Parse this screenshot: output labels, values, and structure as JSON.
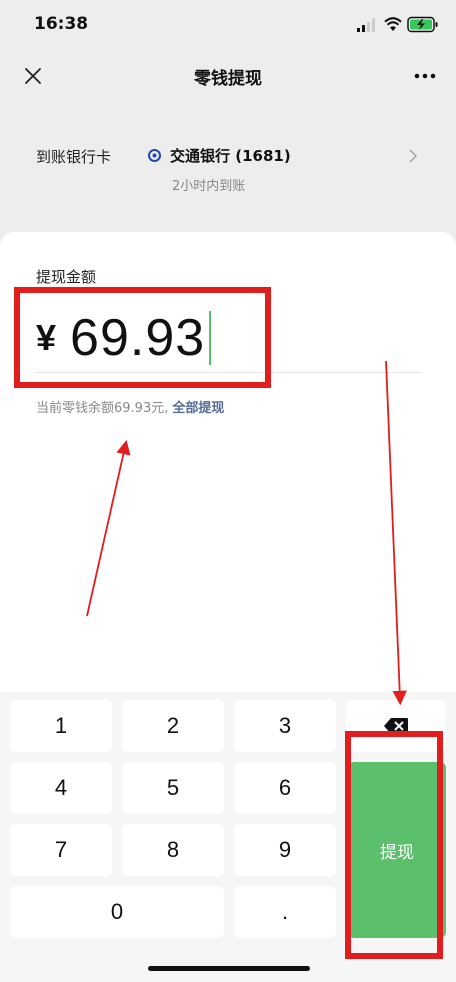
{
  "status_bar": {
    "time": "16:38"
  },
  "nav": {
    "title": "零钱提现"
  },
  "bank": {
    "label": "到账银行卡",
    "name": "交通银行 (1681)",
    "arrival": "2小时内到账"
  },
  "amount": {
    "label": "提现金额",
    "currency": "¥",
    "value": "69.93",
    "balance_text": "当前零钱余额69.93元,",
    "withdraw_all": "全部提现"
  },
  "keypad": {
    "keys": [
      "1",
      "2",
      "3",
      "4",
      "5",
      "6",
      "7",
      "8",
      "9",
      "0",
      "."
    ],
    "submit_label": "提现"
  },
  "colors": {
    "accent_green": "#5bbf6c",
    "link_blue": "#576b95",
    "annotation_red": "#e11d1d"
  }
}
